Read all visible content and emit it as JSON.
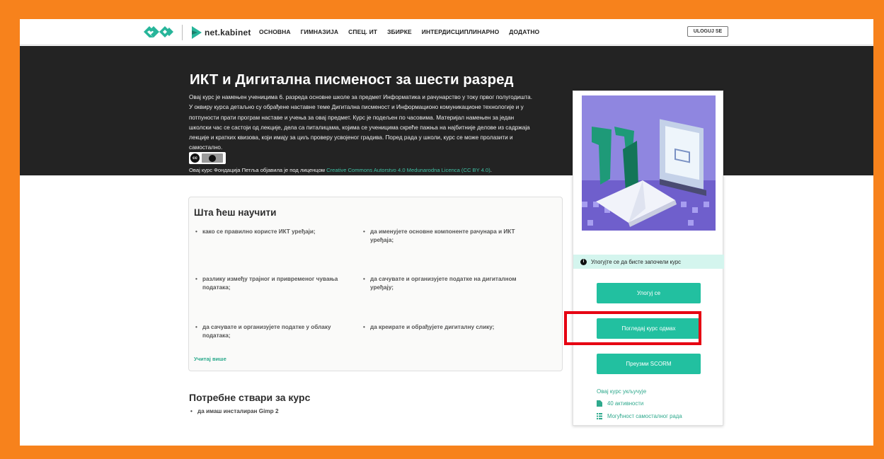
{
  "header": {
    "brand": "net.kabinet",
    "menu": [
      "ОСНОВНА",
      "ГИМНАЗИЈА",
      "СПЕЦ. ИТ",
      "ЗБИРКЕ",
      "ИНТЕРДИСЦИПЛИНАРНО",
      "ДОДАТНО"
    ],
    "login_label": "ULOGUJ SE"
  },
  "course": {
    "title": "ИКТ и Дигитална писменост за шести разред",
    "description": "Овај курс је намењен ученицима 6. разреда основне школе за предмет Информатика и рачунарство у току првог полугодишта. У оквиру курса детаљно су обрађене наставне теме Дигитална писменост и Информационо комуникационе технологије и у потпуности прати програм наставе и учења за овај предмет. Курс је подељен по часовима. Материјал намењен за један школски час се састоји од лекције, дела са питалицама, којима се ученицима скреће пажња на најбитније делове из садржаја лекције и кратких квизова, који имају за циљ проверу усвојеног градива. Поред рада у школи, курс се може пролазити и самостално.",
    "license_prefix": "Овај курс Фондација Петља објавила је под лиценцом ",
    "license_link": "Creative Commons Autorstvo 4.0 Medunarodna Licenca (CC BY 4.0)",
    "license_suffix": "."
  },
  "learn": {
    "title": "Шта ћеш научити",
    "items": [
      "како се правилно користе ИКТ уређаји;",
      "да именујете основне компоненте рачунара и ИКТ уређаја;",
      "разлику између трајног и привременог чувања података;",
      "да сачувате и организујете податке на дигиталном уређају;",
      "да сачувате и организујете податке у облаку података;",
      "да креирате и обрађујете дигиталну слику;"
    ],
    "load_more": "Учитај више"
  },
  "needs": {
    "title": "Потребне ствари за курс",
    "items": [
      "да имаш инсталиран Gimp 2"
    ]
  },
  "card": {
    "notice": "Улогујте се да бисте започели курс",
    "login_button": "Улогуј се",
    "view_button": "Погледај курс одмах",
    "scorm_button": "Преузми SCORM",
    "includes_title": "Овај курс укључује",
    "activities": "40 активности",
    "self_paced": "Могућност самосталног рада"
  },
  "colors": {
    "frame": "#f7821c",
    "accent": "#22c0a0",
    "highlight": "#e60012",
    "hero": "#232323"
  }
}
